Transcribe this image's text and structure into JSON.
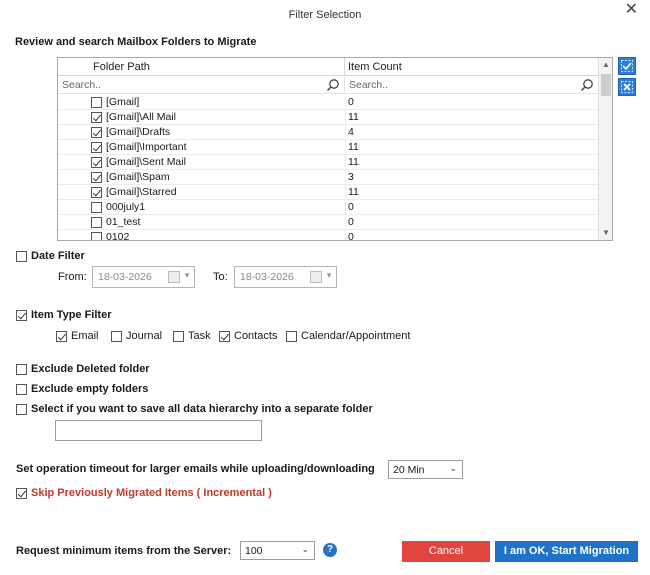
{
  "window": {
    "title": "Filter Selection",
    "close_glyph": "✕"
  },
  "review_label": "Review and search Mailbox Folders to Migrate",
  "grid": {
    "columns": {
      "path": "Folder Path",
      "count": "Item Count"
    },
    "search_placeholder": {
      "path": "Search..",
      "count": "Search.."
    },
    "rows": [
      {
        "path": "[Gmail]",
        "count": "0",
        "checked": false
      },
      {
        "path": "[Gmail]\\All Mail",
        "count": "11",
        "checked": true
      },
      {
        "path": "[Gmail]\\Drafts",
        "count": "4",
        "checked": true
      },
      {
        "path": "[Gmail]\\Important",
        "count": "11",
        "checked": true
      },
      {
        "path": "[Gmail]\\Sent Mail",
        "count": "11",
        "checked": true
      },
      {
        "path": "[Gmail]\\Spam",
        "count": "3",
        "checked": true
      },
      {
        "path": "[Gmail]\\Starred",
        "count": "11",
        "checked": true
      },
      {
        "path": "000july1",
        "count": "0",
        "checked": false
      },
      {
        "path": "01_test",
        "count": "0",
        "checked": false
      },
      {
        "path": "0102",
        "count": "0",
        "checked": false
      }
    ]
  },
  "date_filter": {
    "label": "Date Filter",
    "checked": false,
    "from_label": "From:",
    "from_value": "18-03-2026",
    "to_label": "To:",
    "to_value": "18-03-2026"
  },
  "item_type_filter": {
    "label": "Item Type Filter",
    "checked": true,
    "types": [
      {
        "label": "Email",
        "checked": true
      },
      {
        "label": "Journal",
        "checked": false
      },
      {
        "label": "Task",
        "checked": false
      },
      {
        "label": "Contacts",
        "checked": true
      },
      {
        "label": "Calendar/Appointment",
        "checked": false
      }
    ]
  },
  "options": {
    "exclude_deleted": "Exclude Deleted folder",
    "exclude_empty": "Exclude empty folders",
    "save_hierarchy": "Select if you want to save all data hierarchy into a separate folder",
    "folder_name_value": ""
  },
  "timeout": {
    "label": "Set operation timeout for larger emails while uploading/downloading",
    "value": "20 Min"
  },
  "skip_migrated": {
    "label": "Skip Previously Migrated Items ( Incremental )",
    "checked": true
  },
  "request_min": {
    "label": "Request minimum items from the Server:",
    "value": "100"
  },
  "buttons": {
    "cancel": "Cancel",
    "ok": "I am OK, Start Migration"
  },
  "colors": {
    "primary": "#1e73c8",
    "cancel": "#e0463e",
    "accent_red": "#c0392b"
  }
}
